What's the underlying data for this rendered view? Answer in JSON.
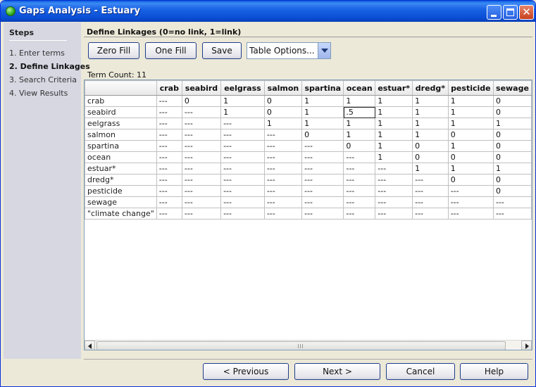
{
  "window": {
    "title": "Gaps Analysis - Estuary",
    "icons": {
      "app": "green-ball-icon",
      "minimize": "minimize-icon",
      "maximize": "maximize-icon",
      "close": "close-icon"
    },
    "accent_color": "#0a4fd6"
  },
  "steps": {
    "title": "Steps",
    "items": [
      {
        "label": "1. Enter terms",
        "active": false
      },
      {
        "label": "2. Define Linkages",
        "active": true
      },
      {
        "label": "3. Search Criteria",
        "active": false
      },
      {
        "label": "4. View Results",
        "active": false
      }
    ]
  },
  "panel": {
    "title": "Define Linkages (0=no link, 1=link)",
    "toolbar": {
      "zero_fill": "Zero Fill",
      "one_fill": "One Fill",
      "save": "Save",
      "table_options": "Table Options..."
    },
    "term_count": "Term Count: 11"
  },
  "table": {
    "columns": [
      "",
      "crab",
      "seabird",
      "eelgrass",
      "salmon",
      "spartina",
      "ocean",
      "estuar*",
      "dredg*",
      "pesticide",
      "sewage"
    ],
    "rows": [
      {
        "term": "crab",
        "cells": [
          "---",
          "0",
          "1",
          "0",
          "1",
          "1",
          "1",
          "1",
          "1",
          "0"
        ]
      },
      {
        "term": "seabird",
        "cells": [
          "---",
          "---",
          "1",
          "0",
          "1",
          ".5",
          "1",
          "1",
          "1",
          "0"
        ]
      },
      {
        "term": "eelgrass",
        "cells": [
          "---",
          "---",
          "---",
          "1",
          "1",
          "1",
          "1",
          "1",
          "1",
          "1"
        ]
      },
      {
        "term": "salmon",
        "cells": [
          "---",
          "---",
          "---",
          "---",
          "0",
          "1",
          "1",
          "1",
          "0",
          "0"
        ]
      },
      {
        "term": "spartina",
        "cells": [
          "---",
          "---",
          "---",
          "---",
          "---",
          "0",
          "1",
          "0",
          "1",
          "0"
        ]
      },
      {
        "term": "ocean",
        "cells": [
          "---",
          "---",
          "---",
          "---",
          "---",
          "---",
          "1",
          "0",
          "0",
          "0"
        ]
      },
      {
        "term": "estuar*",
        "cells": [
          "---",
          "---",
          "---",
          "---",
          "---",
          "---",
          "---",
          "1",
          "1",
          "1"
        ]
      },
      {
        "term": "dredg*",
        "cells": [
          "---",
          "---",
          "---",
          "---",
          "---",
          "---",
          "---",
          "---",
          "0",
          "0"
        ]
      },
      {
        "term": "pesticide",
        "cells": [
          "---",
          "---",
          "---",
          "---",
          "---",
          "---",
          "---",
          "---",
          "---",
          "0"
        ]
      },
      {
        "term": "sewage",
        "cells": [
          "---",
          "---",
          "---",
          "---",
          "---",
          "---",
          "---",
          "---",
          "---",
          "---"
        ]
      },
      {
        "term": "\"climate change\"",
        "cells": [
          "---",
          "---",
          "---",
          "---",
          "---",
          "---",
          "---",
          "---",
          "---",
          "---"
        ]
      }
    ]
  },
  "footer": {
    "previous": "< Previous",
    "next": "Next >",
    "cancel": "Cancel",
    "help": "Help"
  }
}
